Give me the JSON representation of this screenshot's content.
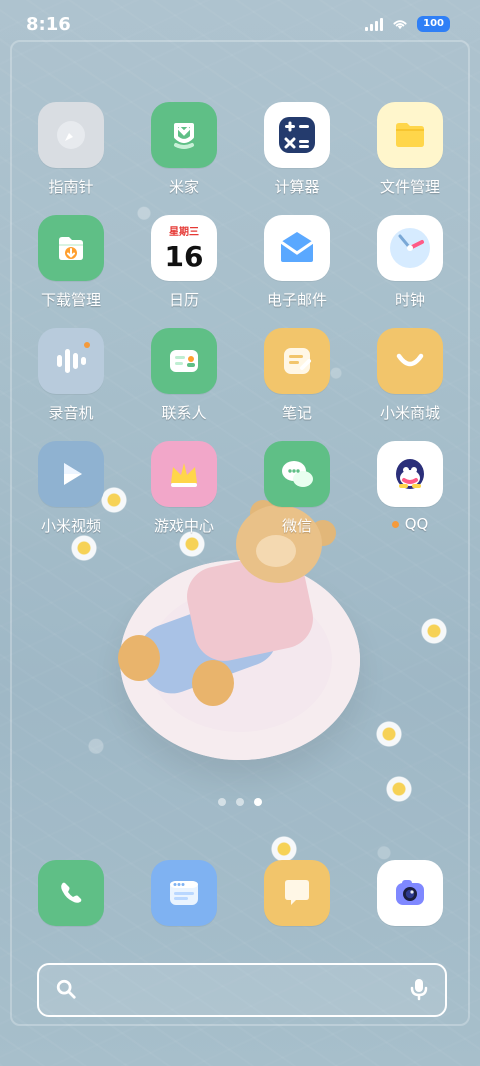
{
  "status_bar": {
    "time": "8:16",
    "battery": "100"
  },
  "apps": [
    {
      "label": "指南针"
    },
    {
      "label": "米家"
    },
    {
      "label": "计算器"
    },
    {
      "label": "文件管理"
    },
    {
      "label": "下载管理"
    },
    {
      "label": "日历",
      "calendar_weekday": "星期三",
      "calendar_day": "16"
    },
    {
      "label": "电子邮件"
    },
    {
      "label": "时钟"
    },
    {
      "label": "录音机"
    },
    {
      "label": "联系人"
    },
    {
      "label": "笔记"
    },
    {
      "label": "小米商城"
    },
    {
      "label": "小米视频"
    },
    {
      "label": "游戏中心"
    },
    {
      "label": "微信"
    },
    {
      "label": "QQ"
    }
  ],
  "dock": [
    {
      "name": "phone-icon"
    },
    {
      "name": "browser-icon"
    },
    {
      "name": "messages-icon"
    },
    {
      "name": "camera-icon"
    }
  ],
  "page_indicator": {
    "count": 3,
    "active_index": 2
  },
  "colors": {
    "accent": "#2f7ff6",
    "notification_dot": "#f59a3a"
  }
}
